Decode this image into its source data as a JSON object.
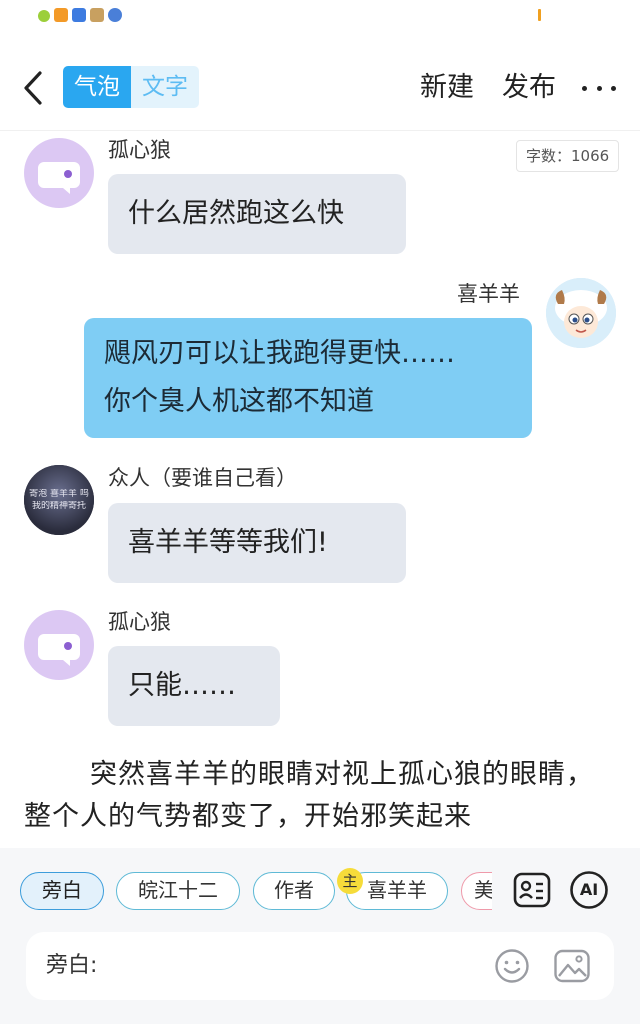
{
  "status_bar": {
    "icons": [
      "app-icon-1",
      "app-icon-2",
      "app-icon-3",
      "app-icon-4",
      "app-icon-5"
    ]
  },
  "top_bar": {
    "mode_bubble": "气泡",
    "mode_text": "文字",
    "new_label": "新建",
    "publish_label": "发布"
  },
  "word_count": "字数：1066",
  "messages": [
    {
      "speaker": "孤心狼",
      "side": "left",
      "lines": [
        "什么居然跑这么快"
      ]
    },
    {
      "speaker": "喜羊羊",
      "side": "right",
      "lines": [
        "飓风刃可以让我跑得更快……",
        "你个臭人机这都不知道"
      ]
    },
    {
      "speaker": "众人（要谁自己看）",
      "side": "left",
      "lines": [
        "喜羊羊等等我们!"
      ],
      "avatar_text": [
        "寄泡 喜羊羊 呜",
        "我的精神寄托"
      ]
    },
    {
      "speaker": "孤心狼",
      "side": "left",
      "lines": [
        "只能……"
      ]
    }
  ],
  "narration": "突然喜羊羊的眼睛对视上孤心狼的眼睛，整个人的气势都变了，开始邪笑起来",
  "roles": {
    "items": [
      "旁白",
      "皖江十二",
      "作者",
      "喜羊羊",
      "美"
    ],
    "selected": "旁白",
    "main_badge": "主"
  },
  "composer": {
    "label": "旁白:",
    "ai_label": "AI"
  },
  "colors": {
    "accent": "#2aa7f0",
    "right_bubble": "#7fcdf4",
    "left_bubble": "#e4e8ef",
    "wolf_avatar": "#dcc8f3",
    "badge": "#f6dc3a"
  }
}
